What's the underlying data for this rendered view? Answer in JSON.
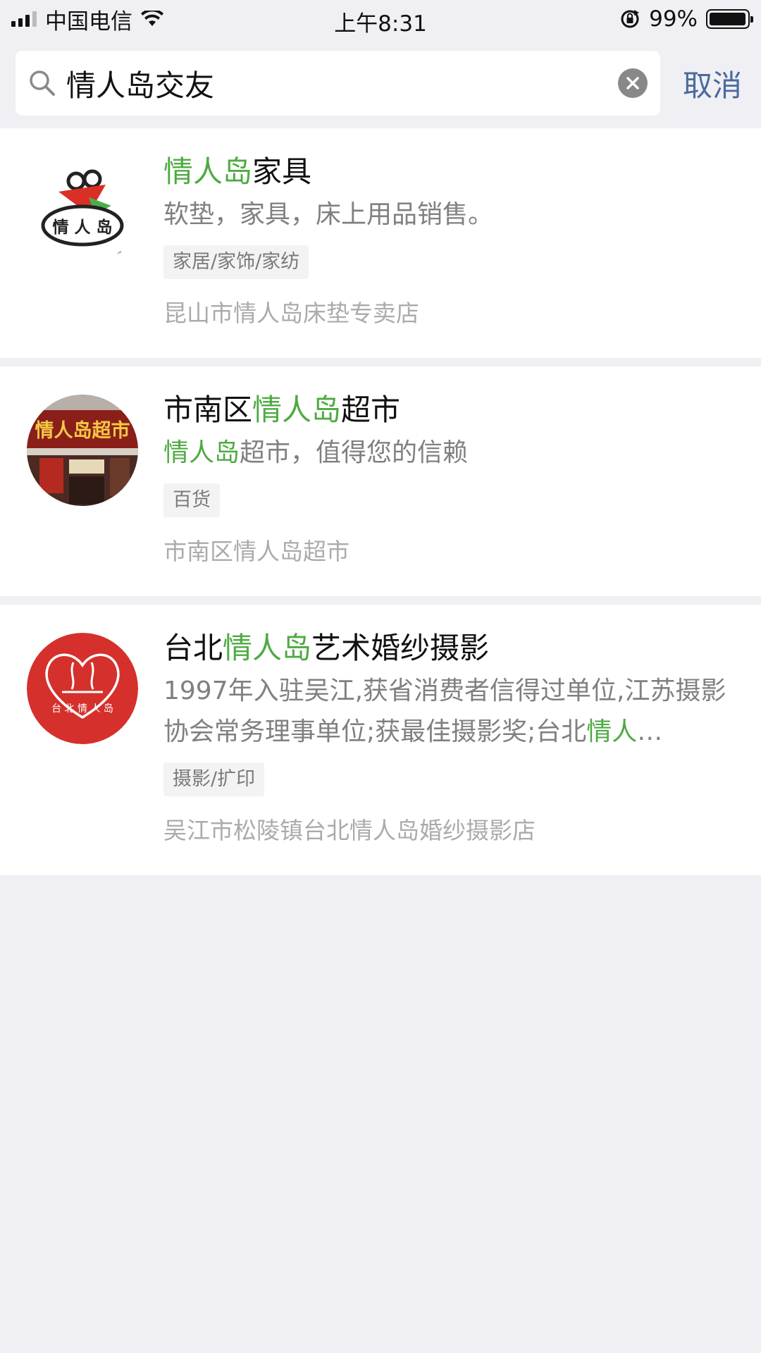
{
  "status_bar": {
    "carrier": "中国电信",
    "time": "上午8:31",
    "battery_percent": "99%",
    "battery_level": 0.99
  },
  "search": {
    "query": "情人岛交友",
    "cancel_label": "取消"
  },
  "colors": {
    "highlight": "#4EAA42",
    "cancel": "#4A6A9C",
    "background": "#EFEFF4"
  },
  "results": [
    {
      "title_pre": "",
      "title_hl": "情人岛",
      "title_post": "家具",
      "desc_pre": "软垫，家具，床上用品销售。",
      "desc_hl": "",
      "desc_post": "",
      "tag": "家居/家饰/家纺",
      "subtitle": "昆山市情人岛床垫专卖店",
      "logo_text": "情 人 岛"
    },
    {
      "title_pre": "市南区",
      "title_hl": "情人岛",
      "title_post": "超市",
      "desc_pre": "",
      "desc_hl": "情人岛",
      "desc_post": "超市，值得您的信赖",
      "tag": "百货",
      "subtitle": "市南区情人岛超市",
      "logo_text": "情人岛超市"
    },
    {
      "title_pre": "台北",
      "title_hl": "情人岛",
      "title_post": "艺术婚纱摄影",
      "desc_pre": "1997年入驻吴江,获省消费者信得过单位,江苏摄影协会常务理事单位;获最佳摄影奖;台北",
      "desc_hl": "情人",
      "desc_post": "…",
      "tag": "摄影/扩印",
      "subtitle": "吴江市松陵镇台北情人岛婚纱摄影店",
      "logo_text": "台 北 情 人 岛"
    }
  ]
}
